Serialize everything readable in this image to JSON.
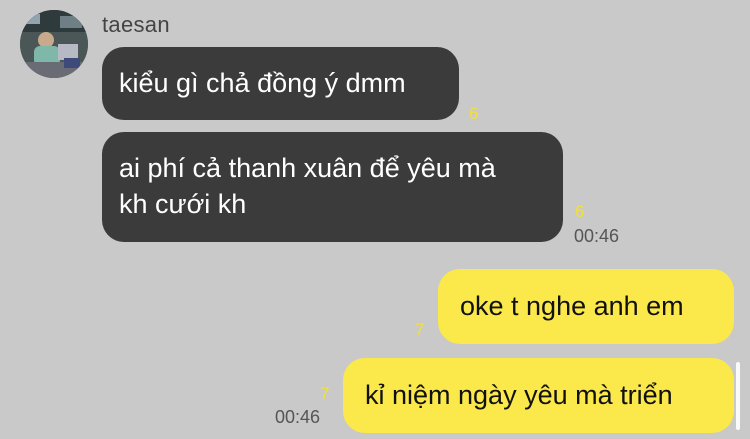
{
  "chat": {
    "sender": "taesan",
    "messages": [
      {
        "direction": "incoming",
        "text": "kiểu gì chả đồng ý dmm",
        "unread": "6",
        "time": ""
      },
      {
        "direction": "incoming",
        "text_lines": [
          "ai phí cả thanh xuân để yêu mà",
          "kh cưới kh"
        ],
        "unread": "6",
        "time": "00:46"
      },
      {
        "direction": "outgoing",
        "text": "oke t nghe anh em",
        "unread": "7",
        "time": ""
      },
      {
        "direction": "outgoing",
        "text": "kỉ niệm ngày yêu mà triển",
        "unread": "7",
        "time": "00:46"
      }
    ]
  },
  "colors": {
    "background": "#c9c9c9",
    "incoming_bubble": "#3b3b3b",
    "outgoing_bubble": "#fbe84b",
    "unread_count": "#f3df3a"
  },
  "icons": {
    "avatar": "sender-profile-photo"
  }
}
